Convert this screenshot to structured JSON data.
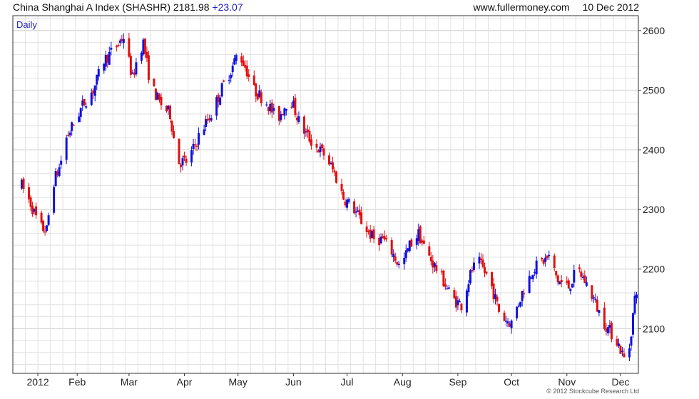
{
  "header": {
    "title": "China Shanghai A Index (SHASHR)",
    "last": "2181.98",
    "change": "+23.07",
    "site": "www.fullermoney.com",
    "date": "10 Dec 2012"
  },
  "footer": {
    "copyright": "© 2012 Stockcube Research Ltd"
  },
  "colors": {
    "up": "#1010e0",
    "down": "#e01010",
    "grid": "#e2e2e2",
    "axis": "#333333",
    "label": "#222222",
    "period": "#2020c0"
  },
  "chart_data": {
    "type": "ohlc",
    "period_label": "Daily",
    "ylim": [
      2025,
      2625
    ],
    "y_ticks": [
      2100,
      2200,
      2300,
      2400,
      2500,
      2600
    ],
    "x_months": [
      {
        "label": "2012",
        "day": 9
      },
      {
        "label": "Feb",
        "day": 31
      },
      {
        "label": "Mar",
        "day": 60
      },
      {
        "label": "Apr",
        "day": 91
      },
      {
        "label": "May",
        "day": 121
      },
      {
        "label": "Jun",
        "day": 152
      },
      {
        "label": "Jul",
        "day": 182
      },
      {
        "label": "Aug",
        "day": 213
      },
      {
        "label": "Sep",
        "day": 244
      },
      {
        "label": "Oct",
        "day": 274
      },
      {
        "label": "Nov",
        "day": 305
      },
      {
        "label": "Dec",
        "day": 335
      }
    ],
    "x_range_days": [
      -5,
      345
    ],
    "anchors": [
      [
        0,
        2340
      ],
      [
        5,
        2310
      ],
      [
        10,
        2270
      ],
      [
        14,
        2265
      ],
      [
        17,
        2340
      ],
      [
        21,
        2370
      ],
      [
        25,
        2420
      ],
      [
        30,
        2450
      ],
      [
        35,
        2480
      ],
      [
        40,
        2500
      ],
      [
        46,
        2550
      ],
      [
        52,
        2570
      ],
      [
        57,
        2590
      ],
      [
        62,
        2520
      ],
      [
        65,
        2560
      ],
      [
        68,
        2580
      ],
      [
        72,
        2510
      ],
      [
        77,
        2480
      ],
      [
        83,
        2460
      ],
      [
        87,
        2380
      ],
      [
        93,
        2380
      ],
      [
        100,
        2430
      ],
      [
        106,
        2460
      ],
      [
        113,
        2510
      ],
      [
        118,
        2540
      ],
      [
        121,
        2565
      ],
      [
        125,
        2540
      ],
      [
        130,
        2500
      ],
      [
        137,
        2480
      ],
      [
        143,
        2450
      ],
      [
        150,
        2490
      ],
      [
        156,
        2440
      ],
      [
        163,
        2410
      ],
      [
        170,
        2390
      ],
      [
        175,
        2360
      ],
      [
        180,
        2320
      ],
      [
        186,
        2300
      ],
      [
        192,
        2270
      ],
      [
        197,
        2250
      ],
      [
        202,
        2250
      ],
      [
        207,
        2230
      ],
      [
        212,
        2200
      ],
      [
        217,
        2240
      ],
      [
        222,
        2260
      ],
      [
        226,
        2230
      ],
      [
        230,
        2210
      ],
      [
        236,
        2180
      ],
      [
        241,
        2150
      ],
      [
        246,
        2140
      ],
      [
        252,
        2200
      ],
      [
        256,
        2210
      ],
      [
        262,
        2180
      ],
      [
        268,
        2120
      ],
      [
        274,
        2110
      ],
      [
        280,
        2160
      ],
      [
        286,
        2200
      ],
      [
        290,
        2210
      ],
      [
        295,
        2220
      ],
      [
        300,
        2180
      ],
      [
        306,
        2170
      ],
      [
        311,
        2200
      ],
      [
        315,
        2180
      ],
      [
        320,
        2150
      ],
      [
        324,
        2120
      ],
      [
        328,
        2100
      ],
      [
        333,
        2080
      ],
      [
        337,
        2050
      ],
      [
        340,
        2070
      ],
      [
        343,
        2150
      ],
      [
        345,
        2182
      ]
    ]
  }
}
